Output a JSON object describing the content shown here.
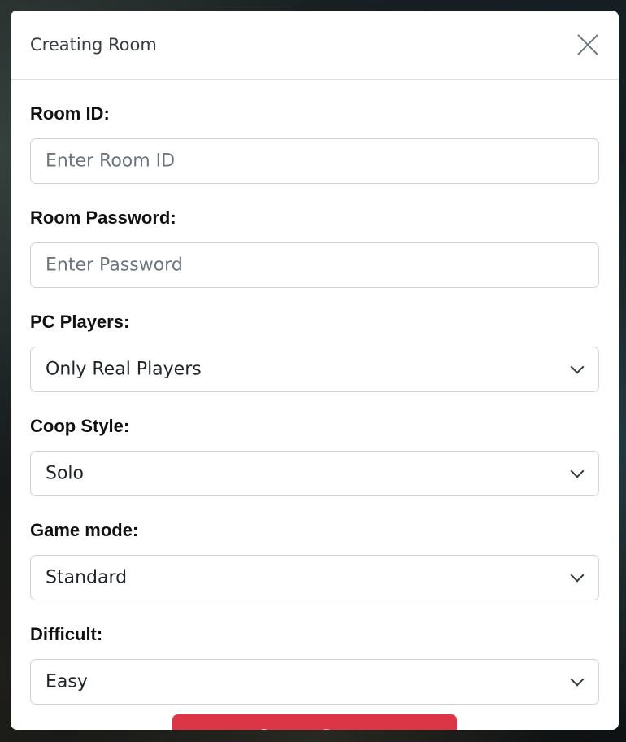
{
  "modal": {
    "title": "Creating Room",
    "close_icon": "close-icon"
  },
  "form": {
    "room_id": {
      "label": "Room ID:",
      "placeholder": "Enter Room ID",
      "value": ""
    },
    "room_password": {
      "label": "Room Password:",
      "placeholder": "Enter Password",
      "value": ""
    },
    "pc_players": {
      "label": "PC Players:",
      "selected": "Only Real Players"
    },
    "coop_style": {
      "label": "Coop Style:",
      "selected": "Solo"
    },
    "game_mode": {
      "label": "Game mode:",
      "selected": "Standard"
    },
    "difficult": {
      "label": "Difficult:",
      "selected": "Easy"
    }
  },
  "actions": {
    "create_label": "Create Room"
  },
  "colors": {
    "primary_button": "#dc3545",
    "border": "#ced4da",
    "placeholder": "#6c757d"
  }
}
